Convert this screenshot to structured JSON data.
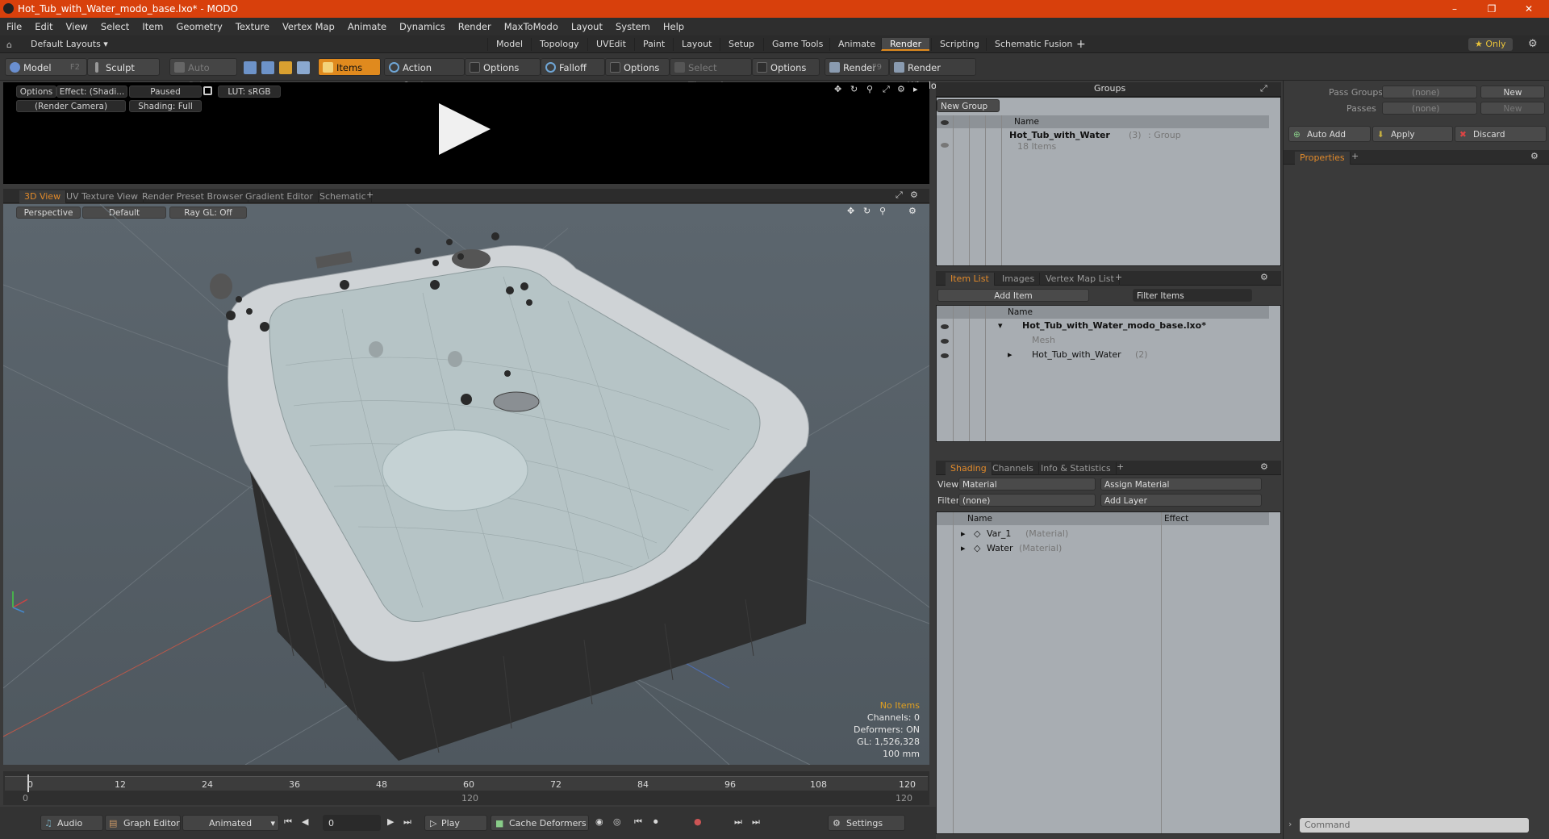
{
  "window": {
    "title": "Hot_Tub_with_Water_modo_base.lxo* - MODO",
    "minimize": "–",
    "maximize": "❐",
    "close": "✕"
  },
  "menu": [
    "File",
    "Edit",
    "View",
    "Select",
    "Item",
    "Geometry",
    "Texture",
    "Vertex Map",
    "Animate",
    "Dynamics",
    "Render",
    "MaxToModo",
    "Layout",
    "System",
    "Help"
  ],
  "layouts": {
    "selector": "Default Layouts ▾",
    "tabs": [
      "Model",
      "Topology",
      "UVEdit",
      "Paint",
      "Layout",
      "Setup",
      "Game Tools",
      "Animate",
      "Render",
      "Scripting",
      "Schematic Fusion"
    ],
    "active": "Render",
    "add": "+",
    "only": "★ Only"
  },
  "toolbar": {
    "model": "Model",
    "model_key": "F2",
    "sculpt": "Sculpt",
    "auto_select": "Auto Select",
    "items": "Items",
    "action_center": "Action Center",
    "options1": "Options",
    "falloff": "Falloff",
    "options2": "Options",
    "select_through": "Select Through",
    "options3": "Options",
    "render": "Render",
    "render_key": "F9",
    "render_window": "Render Window"
  },
  "render_preview": {
    "options": "Options",
    "effect": "Effect: (Shadi...",
    "paused": "Paused",
    "lut": "LUT: sRGB",
    "camera": "(Render Camera)",
    "shading": "Shading: Full"
  },
  "view_tabs": [
    "3D View",
    "UV Texture View",
    "Render Preset Browser",
    "Gradient Editor",
    "Schematic"
  ],
  "viewport": {
    "projection": "Perspective",
    "style": "Default",
    "raygl": "Ray GL: Off",
    "stats": {
      "items": "No Items",
      "channels": "Channels: 0",
      "deformers": "Deformers: ON",
      "gl": "GL: 1,526,328",
      "scale": "100 mm"
    }
  },
  "timeline": {
    "ticks": [
      "0",
      "12",
      "24",
      "36",
      "48",
      "60",
      "72",
      "84",
      "96",
      "108",
      "120"
    ],
    "start": "0",
    "mid": "120",
    "end": "120"
  },
  "bottom": {
    "audio": "Audio",
    "graph_editor": "Graph Editor",
    "animated": "Animated",
    "frame": "0",
    "play": "Play",
    "cache_deformers": "Cache Deformers",
    "settings": "Settings"
  },
  "groups": {
    "title": "Groups",
    "new_group": "New Group",
    "col_name": "Name",
    "item_name": "Hot_Tub_with_Water",
    "item_count": "(3)",
    "item_type": ": Group",
    "item_sub": "18 Items"
  },
  "item_list": {
    "tabs": [
      "Item List",
      "Images",
      "Vertex Map List"
    ],
    "add_item": "Add Item",
    "filter": "Filter Items",
    "col_name": "Name",
    "rows": [
      {
        "name": "Hot_Tub_with_Water_modo_base.lxo*"
      },
      {
        "name": "Mesh"
      },
      {
        "name": "Hot_Tub_with_Water",
        "count": "(2)"
      }
    ]
  },
  "shading": {
    "tabs": [
      "Shading",
      "Channels",
      "Info & Statistics"
    ],
    "view_label": "View",
    "view_value": "Material",
    "assign": "Assign Material",
    "filter_label": "Filter",
    "filter_value": "(none)",
    "add_layer": "Add Layer",
    "col_name": "Name",
    "col_effect": "Effect",
    "rows": [
      {
        "name": "Var_1",
        "type": "(Material)"
      },
      {
        "name": "Water",
        "type": "(Material)"
      }
    ]
  },
  "right": {
    "pass_groups": "Pass Groups",
    "passes": "Passes",
    "none": "(none)",
    "new": "New",
    "auto_add": "Auto Add",
    "apply": "Apply",
    "discard": "Discard",
    "properties": "Properties",
    "command": "Command"
  },
  "colors": {
    "accent": "#e0892a",
    "titlebar": "#d8400c"
  }
}
